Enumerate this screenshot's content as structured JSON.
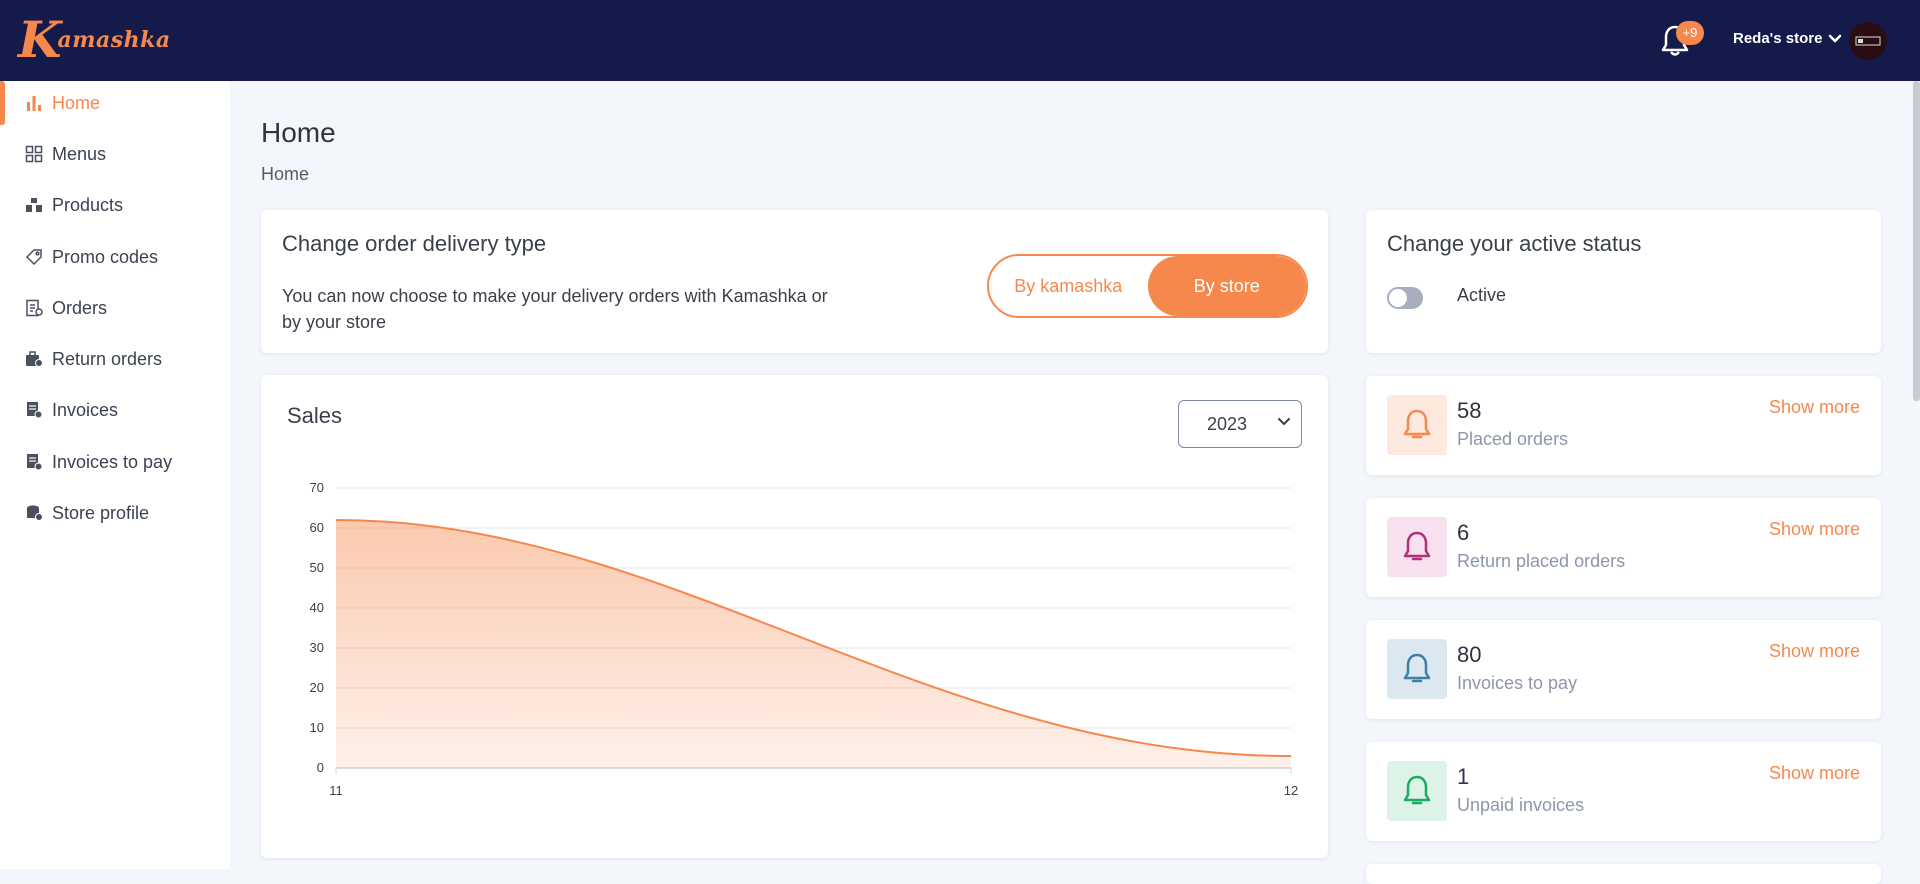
{
  "brand": {
    "logo_letter": "K",
    "logo_rest": "amashka"
  },
  "header": {
    "notification_badge": "+9",
    "store_name": "Reda's store"
  },
  "sidebar": {
    "items": [
      {
        "label": "Home",
        "icon": "bar-chart-icon",
        "active": true
      },
      {
        "label": "Menus",
        "icon": "grid-icon"
      },
      {
        "label": "Products",
        "icon": "boxes-icon"
      },
      {
        "label": "Promo codes",
        "icon": "tag-icon"
      },
      {
        "label": "Orders",
        "icon": "orders-icon"
      },
      {
        "label": "Return orders",
        "icon": "return-icon"
      },
      {
        "label": "Invoices",
        "icon": "invoice-icon"
      },
      {
        "label": "Invoices to pay",
        "icon": "invoice-pay-icon"
      },
      {
        "label": "Store profile",
        "icon": "store-profile-icon"
      }
    ]
  },
  "page": {
    "title": "Home",
    "breadcrumb": "Home"
  },
  "delivery": {
    "title": "Change order delivery type",
    "description_line1": "You can now choose to make your delivery orders with Kamashka or",
    "description_line2": "by your store",
    "option_kamashka": "By kamashka",
    "option_store": "By store",
    "selected": "By store"
  },
  "active_status": {
    "title": "Change your active status",
    "label": "Active",
    "on": false
  },
  "sales": {
    "title": "Sales",
    "year": "2023"
  },
  "stats": [
    {
      "value": "58",
      "label": "Placed orders",
      "link": "Show more",
      "color": "#f7884d",
      "bg": "#fde9dd"
    },
    {
      "value": "6",
      "label": "Return placed orders",
      "link": "Show more",
      "color": "#b0307a",
      "bg": "#f7e1ee"
    },
    {
      "value": "80",
      "label": "Invoices to pay",
      "link": "Show more",
      "color": "#3d7fa6",
      "bg": "#dbe8f0"
    },
    {
      "value": "1",
      "label": "Unpaid invoices",
      "link": "Show more",
      "color": "#1aab62",
      "bg": "#ddf3e8"
    }
  ],
  "colors": {
    "accent": "#f7884d",
    "navy": "#141a4a",
    "background": "#f3f6fb"
  },
  "chart_data": {
    "type": "area",
    "title": "Sales",
    "x": [
      "11",
      "12"
    ],
    "values": [
      62,
      3
    ],
    "ylim": [
      0,
      70
    ],
    "yticks": [
      0,
      10,
      20,
      30,
      40,
      50,
      60,
      70
    ],
    "grid": true,
    "color": "#f7884d"
  }
}
